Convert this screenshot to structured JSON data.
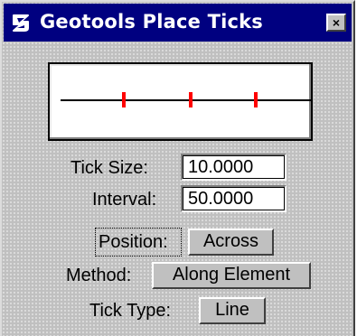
{
  "window": {
    "title": "Geotools Place Ticks",
    "close_glyph": "×",
    "app_icon": "geotools-app-icon",
    "close_icon": "close-icon"
  },
  "preview": {
    "line_color": "#000000",
    "tick_color": "#ff0000",
    "tick_count": 3
  },
  "fields": {
    "tick_size": {
      "label": "Tick Size:",
      "value": "10.0000"
    },
    "interval": {
      "label": "Interval:",
      "value": "50.0000"
    }
  },
  "options": {
    "position": {
      "label": "Position:",
      "value": "Across"
    },
    "method": {
      "label": "Method:",
      "value": "Along Element"
    },
    "tick_type": {
      "label": "Tick Type:",
      "value": "Line"
    }
  },
  "colors": {
    "title_bar": "#000080",
    "dialog_bg": "#c0c0c0"
  }
}
